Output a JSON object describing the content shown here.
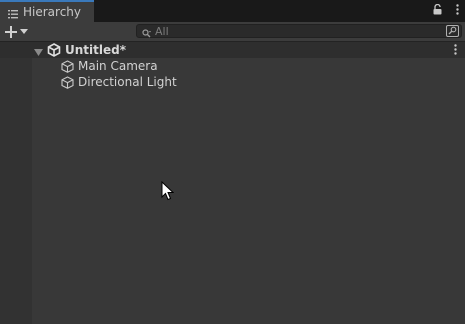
{
  "tab": {
    "title": "Hierarchy",
    "icon": "list-icon"
  },
  "toolbar": {
    "add_icon": "plus-icon",
    "dropdown_icon": "caret-down-icon"
  },
  "search": {
    "placeholder": "All",
    "icon": "search-icon",
    "scope_icon": "search-scope-icon"
  },
  "scene": {
    "name": "Untitled*",
    "icon": "unity-scene-icon",
    "expanded": true
  },
  "objects": [
    {
      "name": "Main Camera",
      "icon": "gameobject-cube-icon"
    },
    {
      "name": "Directional Light",
      "icon": "gameobject-cube-icon"
    }
  ],
  "colors": {
    "background": "#383838",
    "tab_accent": "#3a79bb",
    "scene_row": "#2e2e2e"
  }
}
